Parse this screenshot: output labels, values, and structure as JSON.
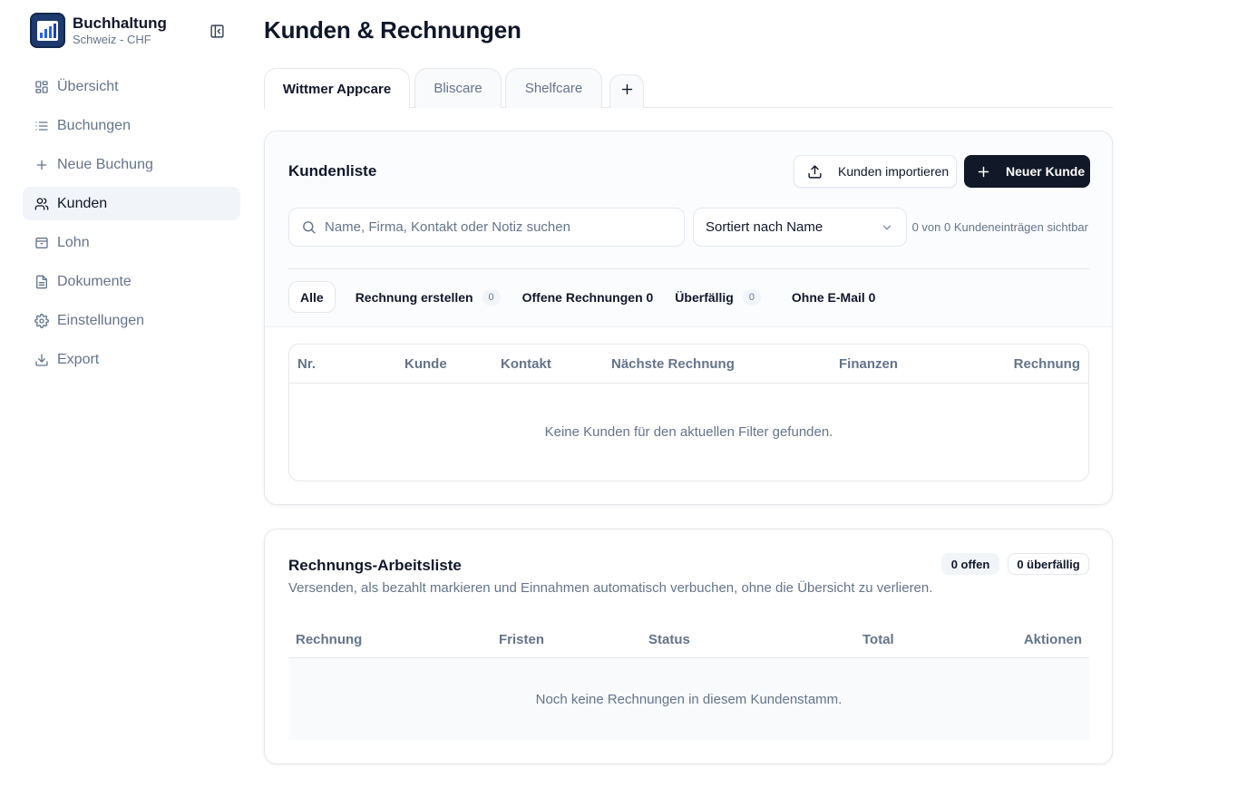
{
  "sidebar": {
    "brand_title": "Buchhaltung",
    "brand_sub": "Schweiz - CHF",
    "items": [
      {
        "label": "Übersicht",
        "icon": "layout-grid-icon"
      },
      {
        "label": "Buchungen",
        "icon": "list-icon"
      },
      {
        "label": "Neue Buchung",
        "icon": "plus-icon"
      },
      {
        "label": "Kunden",
        "icon": "users-icon",
        "active": true
      },
      {
        "label": "Lohn",
        "icon": "archive-icon"
      },
      {
        "label": "Dokumente",
        "icon": "file-text-icon"
      },
      {
        "label": "Einstellungen",
        "icon": "gear-icon"
      },
      {
        "label": "Export",
        "icon": "download-icon"
      }
    ]
  },
  "header": {
    "title": "Kunden & Rechnungen"
  },
  "tabs": [
    {
      "label": "Wittmer Appcare",
      "active": true
    },
    {
      "label": "Bliscare"
    },
    {
      "label": "Shelfcare"
    }
  ],
  "customers": {
    "title": "Kundenliste",
    "import_label": "Kunden importieren",
    "new_label": "Neuer Kunde",
    "search_placeholder": "Name, Firma, Kontakt oder Notiz suchen",
    "sort_value": "Sortiert nach Name",
    "count_text": "0 von 0 Kundeneinträgen sichtbar",
    "filters": {
      "all": "Alle",
      "create_invoice": "Rechnung erstellen",
      "create_invoice_count": "0",
      "open_invoices": "Offene Rechnungen 0",
      "overdue": "Überfällig",
      "overdue_count": "0",
      "no_email": "Ohne E-Mail 0"
    },
    "columns": {
      "nr": "Nr.",
      "customer": "Kunde",
      "contact": "Kontakt",
      "next_invoice": "Nächste Rechnung",
      "finances": "Finanzen",
      "invoice": "Rechnung"
    },
    "empty": "Keine Kunden für den aktuellen Filter gefunden."
  },
  "worklist": {
    "title": "Rechnungs-Arbeitsliste",
    "subtitle": "Versenden, als bezahlt markieren und Einnahmen automatisch verbuchen, ohne die Übersicht zu verlieren.",
    "open_badge": "0 offen",
    "overdue_badge": "0 überfällig",
    "columns": {
      "invoice": "Rechnung",
      "deadlines": "Fristen",
      "status": "Status",
      "total": "Total",
      "actions": "Aktionen"
    },
    "empty": "Noch keine Rechnungen in diesem Kundenstamm."
  },
  "colors": {
    "primary_dark": "#111827",
    "muted_text": "#64748b",
    "active_nav_bg": "#f1f5f9",
    "logo_bg": "#1e3a6e"
  }
}
